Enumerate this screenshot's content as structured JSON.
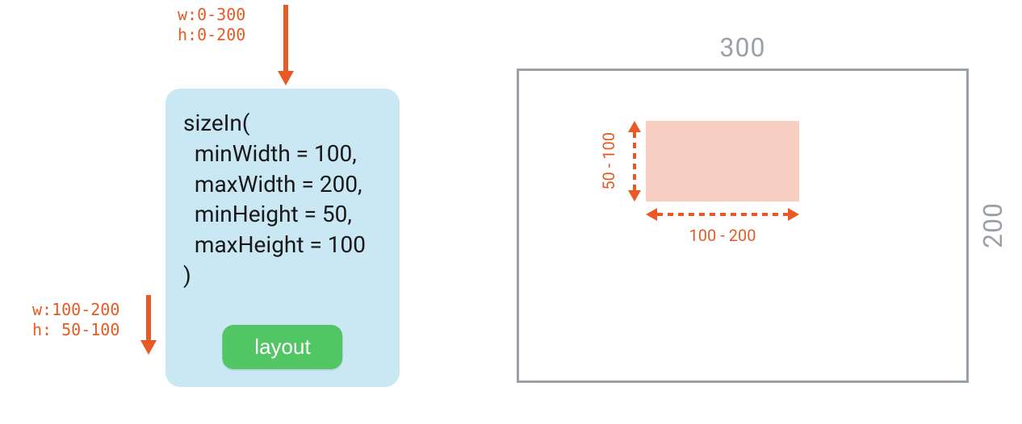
{
  "constraints_in": {
    "width_line": "w:0-300",
    "height_line": "h:0-200"
  },
  "constraints_out": {
    "width_line": "w:100-200",
    "height_line": "h: 50-100"
  },
  "code": {
    "fn": "sizeIn(",
    "p1": "  minWidth = 100,",
    "p2": "  maxWidth = 200,",
    "p3": "  minHeight = 50,",
    "p4": "  maxHeight = 100",
    "close": ")",
    "button": "layout"
  },
  "outer": {
    "width_label": "300",
    "height_label": "200"
  },
  "inner": {
    "width_range": "100 - 200",
    "height_range": "50 - 100"
  },
  "colors": {
    "orange": "#e85a25",
    "card_bg": "#c9e8f4",
    "button_bg": "#52c565",
    "pink": "#f6cfc2",
    "grey": "#9aa0a6"
  }
}
